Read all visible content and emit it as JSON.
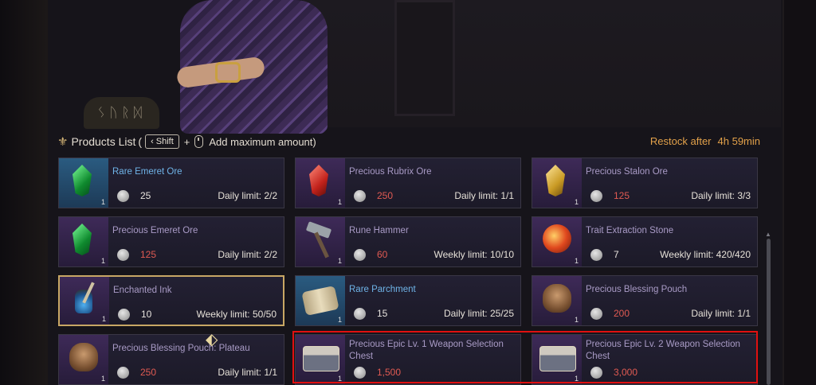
{
  "header": {
    "title": "Products List",
    "open_paren": "(",
    "shift_key": "Shift",
    "plus": "+",
    "hint": "Add maximum amount)",
    "restock_label": "Restock after",
    "restock_time": "4h 59min"
  },
  "background": {
    "sign_text": "ᛊᚢᚱᛞ"
  },
  "products": [
    {
      "name": "Rare Emeret Ore",
      "rarity": "rare",
      "qty": "1",
      "price": "25",
      "price_color": "white",
      "limit": "Daily limit: 2/2",
      "icon": "green-gem-icon"
    },
    {
      "name": "Precious Rubrix Ore",
      "rarity": "precious",
      "qty": "1",
      "price": "250",
      "price_color": "red",
      "limit": "Daily limit: 1/1",
      "icon": "red-gem-icon"
    },
    {
      "name": "Precious Stalon Ore",
      "rarity": "precious",
      "qty": "1",
      "price": "125",
      "price_color": "red",
      "limit": "Daily limit: 3/3",
      "icon": "gold-gem-icon"
    },
    {
      "name": "Precious Emeret Ore",
      "rarity": "precious",
      "qty": "1",
      "price": "125",
      "price_color": "red",
      "limit": "Daily limit: 2/2",
      "icon": "green-gem-icon"
    },
    {
      "name": "Rune Hammer",
      "rarity": "precious",
      "qty": "1",
      "price": "60",
      "price_color": "red",
      "limit": "Weekly limit: 10/10",
      "icon": "hammer-icon"
    },
    {
      "name": "Trait Extraction Stone",
      "rarity": "precious",
      "qty": "1",
      "price": "7",
      "price_color": "white",
      "limit": "Weekly limit: 420/420",
      "icon": "orb-icon"
    },
    {
      "name": "Enchanted Ink",
      "rarity": "precious",
      "qty": "1",
      "price": "10",
      "price_color": "white",
      "limit": "Weekly limit: 50/50",
      "icon": "ink-bottle-icon"
    },
    {
      "name": "Rare Parchment",
      "rarity": "rare",
      "qty": "1",
      "price": "15",
      "price_color": "white",
      "limit": "Daily limit: 25/25",
      "icon": "scroll-icon"
    },
    {
      "name": "Precious Blessing Pouch",
      "rarity": "precious",
      "qty": "1",
      "price": "200",
      "price_color": "red",
      "limit": "Daily limit: 1/1",
      "icon": "pouch-icon"
    },
    {
      "name": "Precious Blessing Pouch: Plateau",
      "rarity": "precious",
      "qty": "1",
      "price": "250",
      "price_color": "red",
      "limit": "Daily limit: 1/1",
      "icon": "pouch-icon"
    },
    {
      "name": "Precious Epic Lv. 1 Weapon Selection Chest",
      "rarity": "precious",
      "qty": "1",
      "price": "1,500",
      "price_color": "red",
      "limit": "",
      "icon": "chest-icon"
    },
    {
      "name": "Precious Epic Lv. 2 Weapon Selection Chest",
      "rarity": "precious",
      "qty": "1",
      "price": "3,000",
      "price_color": "red",
      "limit": "",
      "icon": "chest-icon"
    }
  ],
  "colors": {
    "accent_gold": "#c8a764",
    "restock_orange": "#e2a14a",
    "price_red": "#e05a52",
    "rare_blue": "#6fb4e8",
    "highlight_red": "#e01010"
  }
}
